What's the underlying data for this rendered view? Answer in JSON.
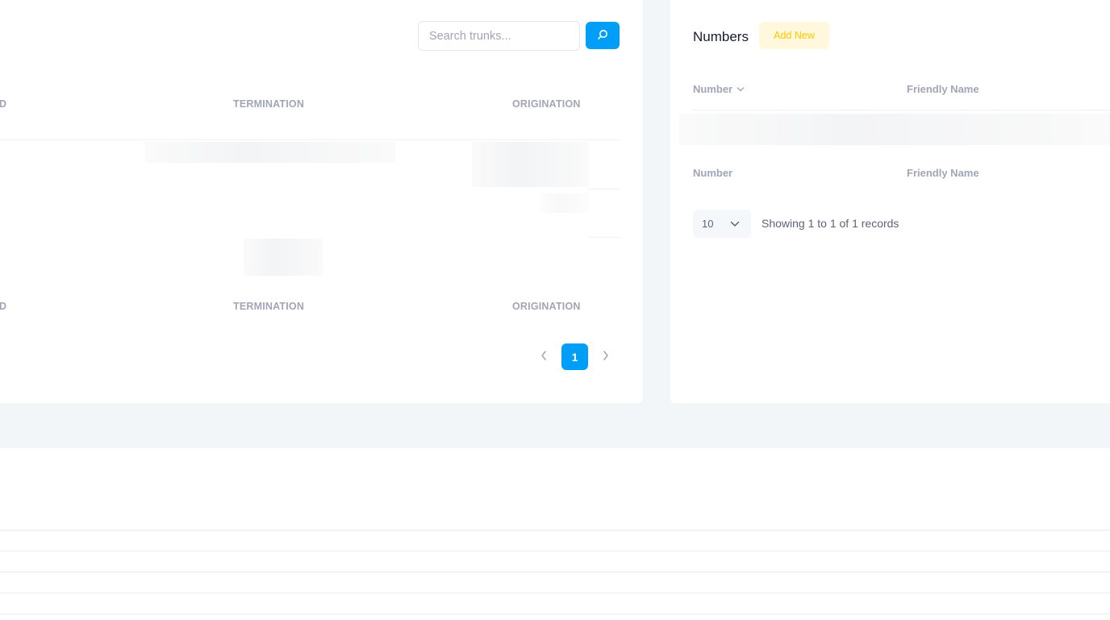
{
  "trunks": {
    "search": {
      "placeholder": "Search trunks...",
      "button_icon": "search-icon"
    },
    "columns_top": [
      "D",
      "TERMINATION",
      "ORIGINATION"
    ],
    "columns_bottom": [
      "D",
      "TERMINATION",
      "ORIGINATION"
    ],
    "pagination": {
      "prev_icon": "chevron-left-icon",
      "current_page": "1",
      "next_icon": "chevron-right-icon"
    }
  },
  "numbers": {
    "title": "Numbers",
    "add_new_label": "Add New",
    "columns_top": [
      "Number",
      "Friendly Name"
    ],
    "sort_icon": "chevron-down-icon",
    "columns_bottom": [
      "Number",
      "Friendly Name"
    ],
    "page_size": "10",
    "page_size_icon": "chevron-down-icon",
    "records_text": "Showing 1 to 1 of 1 records"
  },
  "colors": {
    "accent": "#009ef7",
    "warning_light": "#fff8dd",
    "warning": "#ffc700",
    "muted_text": "#a1a5b7",
    "page_bg": "#f3f6f9"
  }
}
